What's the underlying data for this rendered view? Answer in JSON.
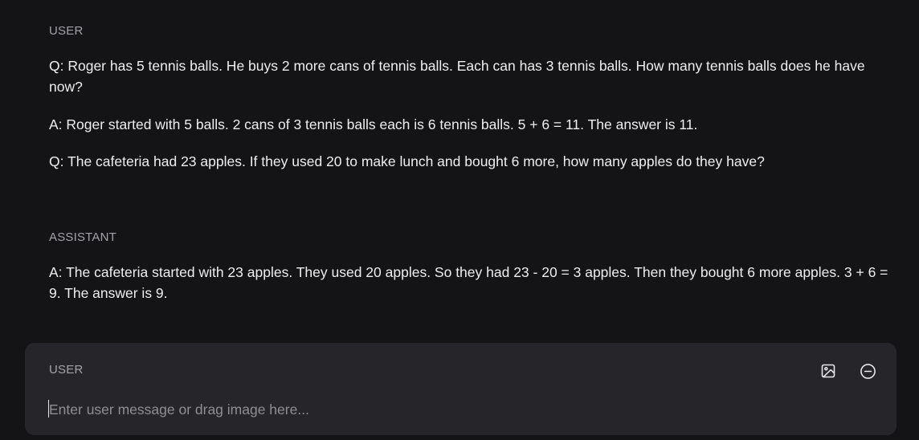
{
  "messages": [
    {
      "role": "USER",
      "paragraphs": [
        "Q: Roger has 5 tennis balls. He buys 2 more cans of tennis balls. Each can has 3 tennis balls. How many tennis balls does he have now?",
        "A: Roger started with 5 balls. 2 cans of 3 tennis balls each is 6 tennis balls. 5 + 6 = 11. The answer is 11.",
        "Q: The cafeteria had 23 apples. If they used 20 to make lunch and bought 6 more, how many apples do they have?"
      ]
    },
    {
      "role": "ASSISTANT",
      "paragraphs": [
        "A: The cafeteria started with 23 apples. They used 20 apples. So they had 23 - 20 = 3 apples. Then they bought 6 more apples. 3 + 6 = 9. The answer is 9."
      ]
    }
  ],
  "composer": {
    "role": "USER",
    "value": "",
    "placeholder": "Enter user message or drag image here...",
    "icons": [
      "image-icon",
      "minus-circle-icon"
    ]
  },
  "colors": {
    "background": "#141416",
    "composer_background": "#26262a",
    "text": "#eeeef0",
    "muted": "#a3a3a8"
  }
}
